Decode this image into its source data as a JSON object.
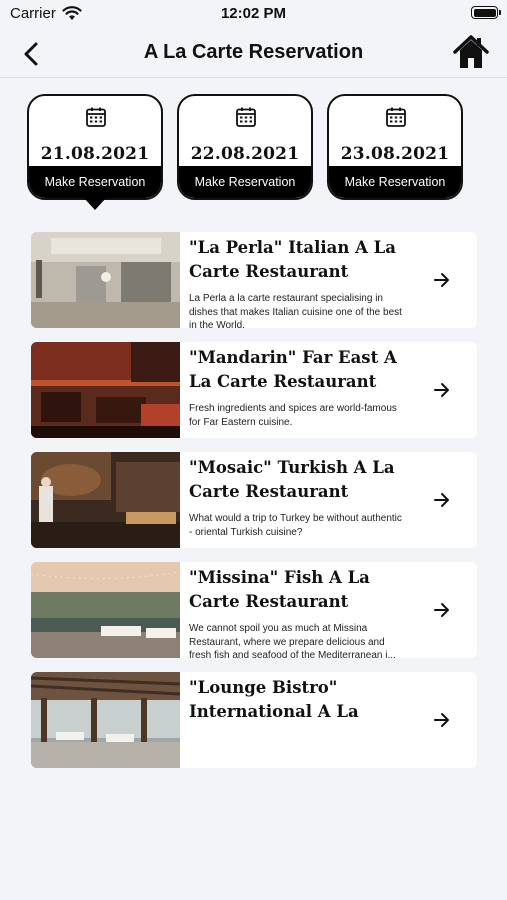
{
  "status_bar": {
    "carrier": "Carrier",
    "time": "12:02 PM"
  },
  "header": {
    "title": "A La Carte Reservation"
  },
  "dates": [
    {
      "date": "21.08.2021",
      "action": "Make Reservation",
      "selected": true
    },
    {
      "date": "22.08.2021",
      "action": "Make Reservation",
      "selected": false
    },
    {
      "date": "23.08.2021",
      "action": "Make Reservation",
      "selected": false
    }
  ],
  "restaurants": [
    {
      "name": "\"La Perla\" Italian A La Carte Restaurant",
      "description": "La Perla a la carte restaurant specialising in dishes that makes Italian cuisine one of the best in the World."
    },
    {
      "name": "\"Mandarin\" Far East A La Carte Restaurant",
      "description": "Fresh ingredients and spices are world-famous for Far Eastern cuisine."
    },
    {
      "name": "\"Mosaic\" Turkish A La Carte Restaurant",
      "description": "What would a trip to Turkey be without authentic - oriental Turkish cuisine?"
    },
    {
      "name": "\"Missina\" Fish A La Carte Restaurant",
      "description": "We cannot spoil you as much at Missina Restaurant, where we prepare delicious and fresh fish and seafood of the Mediterranean i..."
    },
    {
      "name": "\"Lounge Bistro\" International A La Carte...",
      "description": ""
    }
  ]
}
